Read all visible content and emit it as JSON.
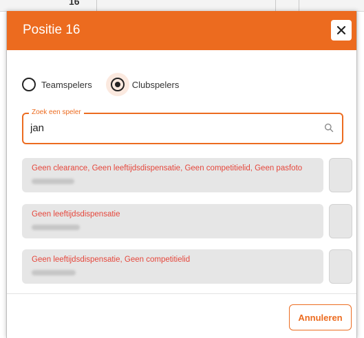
{
  "background": {
    "partial_number": "16"
  },
  "modal": {
    "title": "Positie 16",
    "accent_color": "#ec6b1f",
    "close_icon": "close-icon"
  },
  "radio_group": {
    "options": [
      {
        "label": "Teamspelers",
        "checked": false
      },
      {
        "label": "Clubspelers",
        "checked": true
      }
    ]
  },
  "search": {
    "legend": "Zoek een speler",
    "value": "jan",
    "icon": "search-icon"
  },
  "results": [
    {
      "status": "Geen clearance, Geen leeftijdsdispensatie, Geen competitielid, Geen pasfoto"
    },
    {
      "status": "Geen leeftijdsdispensatie"
    },
    {
      "status": "Geen leeftijdsdispensatie, Geen competitielid"
    }
  ],
  "footer": {
    "cancel_label": "Annuleren"
  }
}
